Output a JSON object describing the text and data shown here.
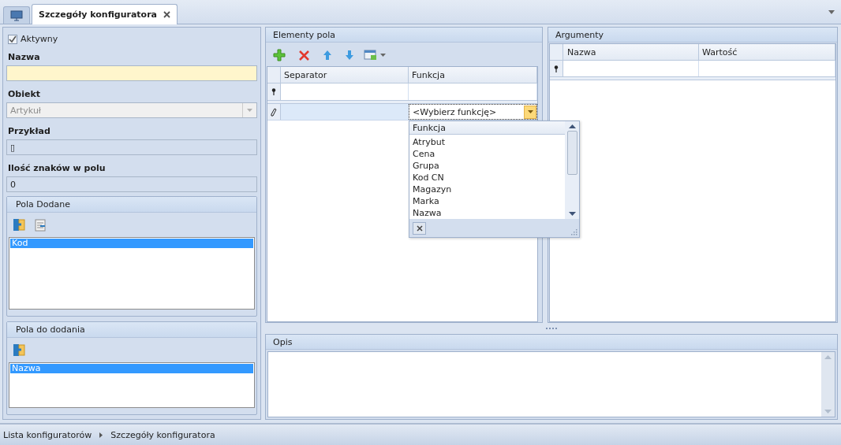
{
  "tabs": [
    {
      "kind": "icon",
      "selected": false
    },
    {
      "kind": "document",
      "label": "Szczegóły konfiguratora",
      "selected": true
    }
  ],
  "general": {
    "active": {
      "label": "Aktywny",
      "checked": true
    },
    "fields": [
      {
        "label": "Nazwa",
        "kind": "required"
      },
      {
        "label": "Obiekt",
        "kind": "combo",
        "value": "Artykuł",
        "disabled": true
      },
      {
        "label": "Przykład",
        "kind": "readonly",
        "value": "▯"
      },
      {
        "label": "Ilość znaków w polu",
        "kind": "readonly",
        "value": "0"
      }
    ]
  },
  "lists": [
    {
      "title": "Pola Dodane",
      "kind": "added",
      "items": [
        {
          "label": "Kod",
          "selected": true
        }
      ]
    },
    {
      "title": "Pola do dodania",
      "kind": "available",
      "items": [
        {
          "label": "Nazwa",
          "selected": true
        }
      ]
    }
  ],
  "elements": {
    "title": "Elementy pola",
    "columns": [
      "Separator",
      "Funkcja"
    ],
    "edit_row": {
      "value": "<Wybierz funkcję>"
    },
    "dropdown": {
      "header": "Funkcja",
      "items": [
        "Atrybut",
        "Cena",
        "Grupa",
        "Kod CN",
        "Magazyn",
        "Marka",
        "Nazwa"
      ]
    }
  },
  "arguments": {
    "title": "Argumenty",
    "columns": [
      "Nazwa",
      "Wartość"
    ]
  },
  "description": {
    "title": "Opis"
  },
  "breadcrumb": [
    "Lista konfiguratorów",
    "Szczegóły konfiguratora"
  ]
}
